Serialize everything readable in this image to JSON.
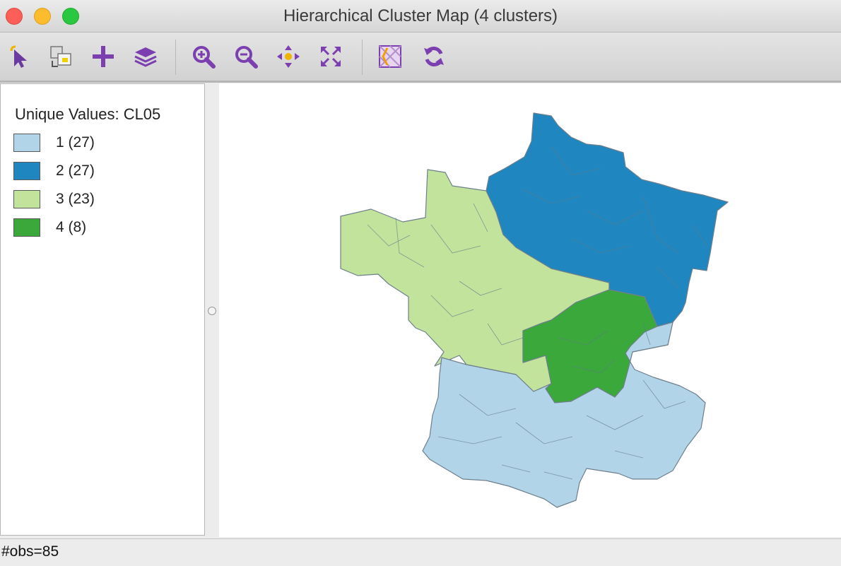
{
  "window": {
    "title": "Hierarchical Cluster Map (4 clusters)"
  },
  "toolbar": {
    "tools": [
      {
        "name": "select-tool",
        "icon": "pointer-icon"
      },
      {
        "name": "selection-shape-tool",
        "icon": "selection-shape-icon"
      },
      {
        "name": "add-tool",
        "icon": "plus-icon"
      },
      {
        "name": "layers-tool",
        "icon": "layers-icon"
      },
      {
        "name": "zoom-in-tool",
        "icon": "zoom-in-icon"
      },
      {
        "name": "zoom-out-tool",
        "icon": "zoom-out-icon"
      },
      {
        "name": "pan-tool",
        "icon": "pan-icon"
      },
      {
        "name": "fit-extent-tool",
        "icon": "fit-extent-icon"
      },
      {
        "name": "basemap-tool",
        "icon": "basemap-icon"
      },
      {
        "name": "refresh-tool",
        "icon": "refresh-icon"
      }
    ],
    "icon_color": "#7b3fb0"
  },
  "legend": {
    "title": "Unique Values: CL05",
    "items": [
      {
        "label": "1 (27)",
        "color": "#b2d4e8"
      },
      {
        "label": "2 (27)",
        "color": "#1f86c0"
      },
      {
        "label": "3 (23)",
        "color": "#c2e39c"
      },
      {
        "label": "4 (8)",
        "color": "#3aa83a"
      }
    ]
  },
  "map": {
    "region": "France (departements)",
    "cluster_colors": {
      "1": "#b2d4e8",
      "2": "#1f86c0",
      "3": "#c2e39c",
      "4": "#3aa83a"
    },
    "outline_color": "#6e7f8c"
  },
  "status": {
    "text": "#obs=85"
  }
}
